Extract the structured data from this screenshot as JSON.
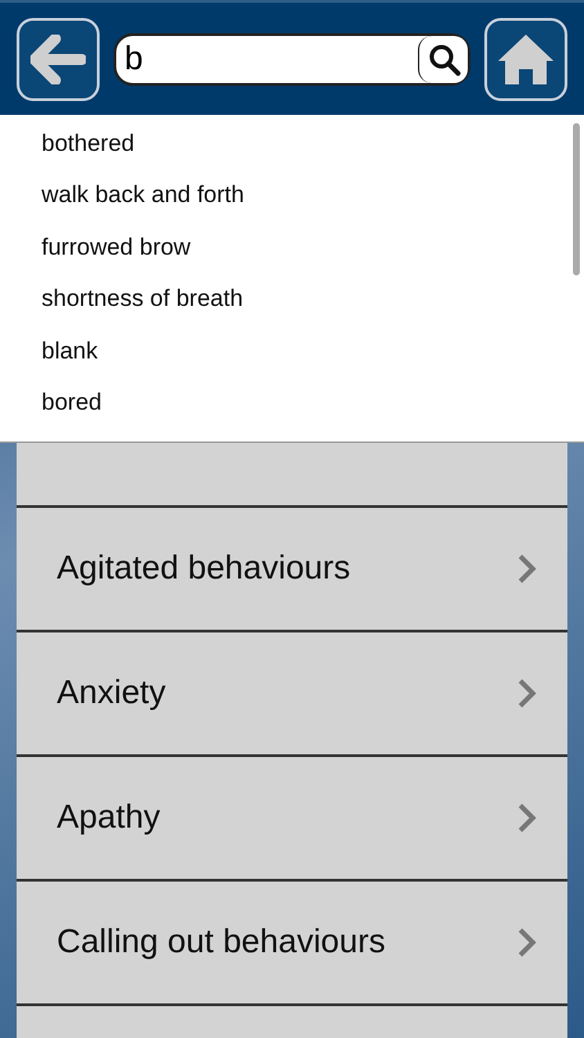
{
  "search": {
    "value": "b"
  },
  "suggestions": [
    "bothered",
    "walk back and forth",
    "furrowed brow",
    "shortness of breath",
    "blank",
    "bored"
  ],
  "categories": [
    {
      "label": "Agitated behaviours"
    },
    {
      "label": "Anxiety"
    },
    {
      "label": "Apathy"
    },
    {
      "label": "Calling out behaviours"
    }
  ]
}
